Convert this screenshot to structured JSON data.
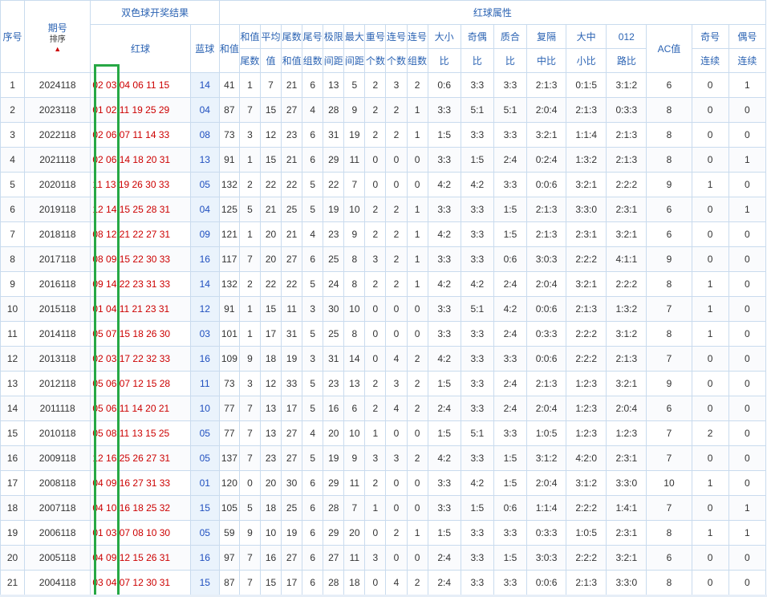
{
  "header": {
    "seq": "序号",
    "issue": "期号",
    "sort": "排序",
    "draw_result": "双色球开奖结果",
    "red_attr": "红球属性",
    "red_ball": "红球",
    "blue_ball": "蓝球",
    "sum_value": "和值",
    "sum_tail": [
      "和值",
      "尾数"
    ],
    "avg": [
      "平均",
      "值"
    ],
    "tail_sum": [
      "尾数",
      "和值"
    ],
    "tail_group": [
      "尾号",
      "组数"
    ],
    "max_span": [
      "极限",
      "间距"
    ],
    "max_gap": [
      "最大",
      "间距"
    ],
    "repeat_count": [
      "重号",
      "个数"
    ],
    "consec_count": [
      "连号",
      "个数"
    ],
    "consec_group": [
      "连号",
      "组数"
    ],
    "big_small": [
      "大小",
      "比"
    ],
    "odd_even": [
      "奇偶",
      "比"
    ],
    "prime_comp": [
      "质合",
      "比"
    ],
    "repeat_gap": [
      "复隔",
      "中比"
    ],
    "big_mid_small": [
      "大中",
      "小比"
    ],
    "route012": [
      "012",
      "路比"
    ],
    "ac": "AC值",
    "odd_run": [
      "奇号",
      "连续"
    ],
    "even_run": [
      "偶号",
      "连续"
    ]
  },
  "rows": [
    {
      "seq": "1",
      "issue": "2024118",
      "first": "02",
      "rest": "03 04 06 11 15",
      "blue": "14",
      "sum": "41",
      "tail": "1",
      "avg": "7",
      "tsum": "21",
      "tgroup": "6",
      "span": "13",
      "gap": "5",
      "rep": "2",
      "cnt": "3",
      "cgrp": "2",
      "bs": "0:6",
      "oe": "3:3",
      "pc": "3:3",
      "rg": "2:1:3",
      "bms": "0:1:5",
      "r012": "3:1:2",
      "ac": "6",
      "oddr": "0",
      "evenr": "1"
    },
    {
      "seq": "2",
      "issue": "2023118",
      "first": "01",
      "rest": "02 11 19 25 29",
      "blue": "04",
      "sum": "87",
      "tail": "7",
      "avg": "15",
      "tsum": "27",
      "tgroup": "4",
      "span": "28",
      "gap": "9",
      "rep": "2",
      "cnt": "2",
      "cgrp": "1",
      "bs": "3:3",
      "oe": "5:1",
      "pc": "5:1",
      "rg": "2:0:4",
      "bms": "2:1:3",
      "r012": "0:3:3",
      "ac": "8",
      "oddr": "0",
      "evenr": "0"
    },
    {
      "seq": "3",
      "issue": "2022118",
      "first": "02",
      "rest": "06 07 11 14 33",
      "blue": "08",
      "sum": "73",
      "tail": "3",
      "avg": "12",
      "tsum": "23",
      "tgroup": "6",
      "span": "31",
      "gap": "19",
      "rep": "2",
      "cnt": "2",
      "cgrp": "1",
      "bs": "1:5",
      "oe": "3:3",
      "pc": "3:3",
      "rg": "3:2:1",
      "bms": "1:1:4",
      "r012": "2:1:3",
      "ac": "8",
      "oddr": "0",
      "evenr": "0"
    },
    {
      "seq": "4",
      "issue": "2021118",
      "first": "02",
      "rest": "06 14 18 20 31",
      "blue": "13",
      "sum": "91",
      "tail": "1",
      "avg": "15",
      "tsum": "21",
      "tgroup": "6",
      "span": "29",
      "gap": "11",
      "rep": "0",
      "cnt": "0",
      "cgrp": "0",
      "bs": "3:3",
      "oe": "1:5",
      "pc": "2:4",
      "rg": "0:2:4",
      "bms": "1:3:2",
      "r012": "2:1:3",
      "ac": "8",
      "oddr": "0",
      "evenr": "1"
    },
    {
      "seq": "5",
      "issue": "2020118",
      "first": "11",
      "rest": "13 19 26 30 33",
      "blue": "05",
      "sum": "132",
      "tail": "2",
      "avg": "22",
      "tsum": "22",
      "tgroup": "5",
      "span": "22",
      "gap": "7",
      "rep": "0",
      "cnt": "0",
      "cgrp": "0",
      "bs": "4:2",
      "oe": "4:2",
      "pc": "3:3",
      "rg": "0:0:6",
      "bms": "3:2:1",
      "r012": "2:2:2",
      "ac": "9",
      "oddr": "1",
      "evenr": "0"
    },
    {
      "seq": "6",
      "issue": "2019118",
      "first": "12",
      "rest": "14 15 25 28 31",
      "blue": "04",
      "sum": "125",
      "tail": "5",
      "avg": "21",
      "tsum": "25",
      "tgroup": "5",
      "span": "19",
      "gap": "10",
      "rep": "2",
      "cnt": "2",
      "cgrp": "1",
      "bs": "3:3",
      "oe": "3:3",
      "pc": "1:5",
      "rg": "2:1:3",
      "bms": "3:3:0",
      "r012": "2:3:1",
      "ac": "6",
      "oddr": "0",
      "evenr": "1"
    },
    {
      "seq": "7",
      "issue": "2018118",
      "first": "08",
      "rest": "12 21 22 27 31",
      "blue": "09",
      "sum": "121",
      "tail": "1",
      "avg": "20",
      "tsum": "21",
      "tgroup": "4",
      "span": "23",
      "gap": "9",
      "rep": "2",
      "cnt": "2",
      "cgrp": "1",
      "bs": "4:2",
      "oe": "3:3",
      "pc": "1:5",
      "rg": "2:1:3",
      "bms": "2:3:1",
      "r012": "3:2:1",
      "ac": "6",
      "oddr": "0",
      "evenr": "0"
    },
    {
      "seq": "8",
      "issue": "2017118",
      "first": "08",
      "rest": "09 15 22 30 33",
      "blue": "16",
      "sum": "117",
      "tail": "7",
      "avg": "20",
      "tsum": "27",
      "tgroup": "6",
      "span": "25",
      "gap": "8",
      "rep": "3",
      "cnt": "2",
      "cgrp": "1",
      "bs": "3:3",
      "oe": "3:3",
      "pc": "0:6",
      "rg": "3:0:3",
      "bms": "2:2:2",
      "r012": "4:1:1",
      "ac": "9",
      "oddr": "0",
      "evenr": "0"
    },
    {
      "seq": "9",
      "issue": "2016118",
      "first": "09",
      "rest": "14 22 23 31 33",
      "blue": "14",
      "sum": "132",
      "tail": "2",
      "avg": "22",
      "tsum": "22",
      "tgroup": "5",
      "span": "24",
      "gap": "8",
      "rep": "2",
      "cnt": "2",
      "cgrp": "1",
      "bs": "4:2",
      "oe": "4:2",
      "pc": "2:4",
      "rg": "2:0:4",
      "bms": "3:2:1",
      "r012": "2:2:2",
      "ac": "8",
      "oddr": "1",
      "evenr": "0"
    },
    {
      "seq": "10",
      "issue": "2015118",
      "first": "01",
      "rest": "04 11 21 23 31",
      "blue": "12",
      "sum": "91",
      "tail": "1",
      "avg": "15",
      "tsum": "11",
      "tgroup": "3",
      "span": "30",
      "gap": "10",
      "rep": "0",
      "cnt": "0",
      "cgrp": "0",
      "bs": "3:3",
      "oe": "5:1",
      "pc": "4:2",
      "rg": "0:0:6",
      "bms": "2:1:3",
      "r012": "1:3:2",
      "ac": "7",
      "oddr": "1",
      "evenr": "0"
    },
    {
      "seq": "11",
      "issue": "2014118",
      "first": "05",
      "rest": "07 15 18 26 30",
      "blue": "03",
      "sum": "101",
      "tail": "1",
      "avg": "17",
      "tsum": "31",
      "tgroup": "5",
      "span": "25",
      "gap": "8",
      "rep": "0",
      "cnt": "0",
      "cgrp": "0",
      "bs": "3:3",
      "oe": "3:3",
      "pc": "2:4",
      "rg": "0:3:3",
      "bms": "2:2:2",
      "r012": "3:1:2",
      "ac": "8",
      "oddr": "1",
      "evenr": "0"
    },
    {
      "seq": "12",
      "issue": "2013118",
      "first": "02",
      "rest": "03 17 22 32 33",
      "blue": "16",
      "sum": "109",
      "tail": "9",
      "avg": "18",
      "tsum": "19",
      "tgroup": "3",
      "span": "31",
      "gap": "14",
      "rep": "0",
      "cnt": "4",
      "cgrp": "2",
      "bs": "4:2",
      "oe": "3:3",
      "pc": "3:3",
      "rg": "0:0:6",
      "bms": "2:2:2",
      "r012": "2:1:3",
      "ac": "7",
      "oddr": "0",
      "evenr": "0"
    },
    {
      "seq": "13",
      "issue": "2012118",
      "first": "05",
      "rest": "06 07 12 15 28",
      "blue": "11",
      "sum": "73",
      "tail": "3",
      "avg": "12",
      "tsum": "33",
      "tgroup": "5",
      "span": "23",
      "gap": "13",
      "rep": "2",
      "cnt": "3",
      "cgrp": "2",
      "bs": "1:5",
      "oe": "3:3",
      "pc": "2:4",
      "rg": "2:1:3",
      "bms": "1:2:3",
      "r012": "3:2:1",
      "ac": "9",
      "oddr": "0",
      "evenr": "0"
    },
    {
      "seq": "14",
      "issue": "2011118",
      "first": "05",
      "rest": "06 11 14 20 21",
      "blue": "10",
      "sum": "77",
      "tail": "7",
      "avg": "13",
      "tsum": "17",
      "tgroup": "5",
      "span": "16",
      "gap": "6",
      "rep": "2",
      "cnt": "4",
      "cgrp": "2",
      "bs": "2:4",
      "oe": "3:3",
      "pc": "2:4",
      "rg": "2:0:4",
      "bms": "1:2:3",
      "r012": "2:0:4",
      "ac": "6",
      "oddr": "0",
      "evenr": "0"
    },
    {
      "seq": "15",
      "issue": "2010118",
      "first": "05",
      "rest": "08 11 13 15 25",
      "blue": "05",
      "sum": "77",
      "tail": "7",
      "avg": "13",
      "tsum": "27",
      "tgroup": "4",
      "span": "20",
      "gap": "10",
      "rep": "1",
      "cnt": "0",
      "cgrp": "0",
      "bs": "1:5",
      "oe": "5:1",
      "pc": "3:3",
      "rg": "1:0:5",
      "bms": "1:2:3",
      "r012": "1:2:3",
      "ac": "7",
      "oddr": "2",
      "evenr": "0"
    },
    {
      "seq": "16",
      "issue": "2009118",
      "first": "12",
      "rest": "16 25 26 27 31",
      "blue": "05",
      "sum": "137",
      "tail": "7",
      "avg": "23",
      "tsum": "27",
      "tgroup": "5",
      "span": "19",
      "gap": "9",
      "rep": "3",
      "cnt": "3",
      "cgrp": "2",
      "bs": "4:2",
      "oe": "3:3",
      "pc": "1:5",
      "rg": "3:1:2",
      "bms": "4:2:0",
      "r012": "2:3:1",
      "ac": "7",
      "oddr": "0",
      "evenr": "0"
    },
    {
      "seq": "17",
      "issue": "2008118",
      "first": "04",
      "rest": "09 16 27 31 33",
      "blue": "01",
      "sum": "120",
      "tail": "0",
      "avg": "20",
      "tsum": "30",
      "tgroup": "6",
      "span": "29",
      "gap": "11",
      "rep": "2",
      "cnt": "0",
      "cgrp": "0",
      "bs": "3:3",
      "oe": "4:2",
      "pc": "1:5",
      "rg": "2:0:4",
      "bms": "3:1:2",
      "r012": "3:3:0",
      "ac": "10",
      "oddr": "1",
      "evenr": "0"
    },
    {
      "seq": "18",
      "issue": "2007118",
      "first": "04",
      "rest": "10 16 18 25 32",
      "blue": "15",
      "sum": "105",
      "tail": "5",
      "avg": "18",
      "tsum": "25",
      "tgroup": "6",
      "span": "28",
      "gap": "7",
      "rep": "1",
      "cnt": "0",
      "cgrp": "0",
      "bs": "3:3",
      "oe": "1:5",
      "pc": "0:6",
      "rg": "1:1:4",
      "bms": "2:2:2",
      "r012": "1:4:1",
      "ac": "7",
      "oddr": "0",
      "evenr": "1"
    },
    {
      "seq": "19",
      "issue": "2006118",
      "first": "01",
      "rest": "03 07 08 10 30",
      "blue": "05",
      "sum": "59",
      "tail": "9",
      "avg": "10",
      "tsum": "19",
      "tgroup": "6",
      "span": "29",
      "gap": "20",
      "rep": "0",
      "cnt": "2",
      "cgrp": "1",
      "bs": "1:5",
      "oe": "3:3",
      "pc": "3:3",
      "rg": "0:3:3",
      "bms": "1:0:5",
      "r012": "2:3:1",
      "ac": "8",
      "oddr": "1",
      "evenr": "1"
    },
    {
      "seq": "20",
      "issue": "2005118",
      "first": "04",
      "rest": "09 12 15 26 31",
      "blue": "16",
      "sum": "97",
      "tail": "7",
      "avg": "16",
      "tsum": "27",
      "tgroup": "6",
      "span": "27",
      "gap": "11",
      "rep": "3",
      "cnt": "0",
      "cgrp": "0",
      "bs": "2:4",
      "oe": "3:3",
      "pc": "1:5",
      "rg": "3:0:3",
      "bms": "2:2:2",
      "r012": "3:2:1",
      "ac": "6",
      "oddr": "0",
      "evenr": "0"
    },
    {
      "seq": "21",
      "issue": "2004118",
      "first": "03",
      "rest": "04 07 12 30 31",
      "blue": "15",
      "sum": "87",
      "tail": "7",
      "avg": "15",
      "tsum": "17",
      "tgroup": "6",
      "span": "28",
      "gap": "18",
      "rep": "0",
      "cnt": "4",
      "cgrp": "2",
      "bs": "2:4",
      "oe": "3:3",
      "pc": "3:3",
      "rg": "0:0:6",
      "bms": "2:1:3",
      "r012": "3:3:0",
      "ac": "8",
      "oddr": "0",
      "evenr": "0"
    }
  ]
}
